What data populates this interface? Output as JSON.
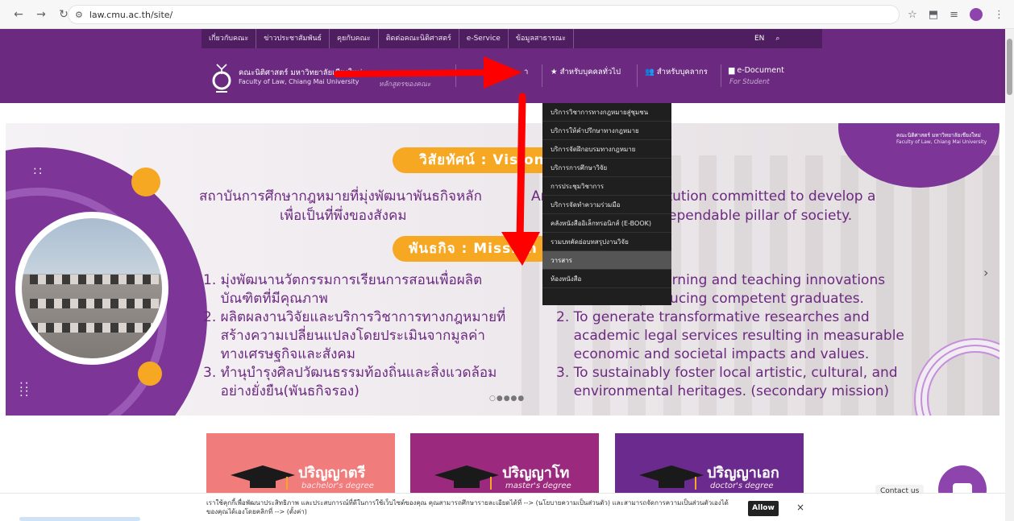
{
  "browser": {
    "url": "law.cmu.ac.th/site/",
    "back_icon": "back-arrow-icon",
    "forward_icon": "forward-arrow-icon",
    "reload_icon": "reload-icon"
  },
  "topbar": {
    "links": [
      "เกี่ยวกับคณะ",
      "ข่าวประชาสัมพันธ์",
      "คุยกับคณะ",
      "ติดต่อคณะนิติศาสตร์",
      "e-Service",
      "ข้อมูลสาธารณะ"
    ],
    "lang": "EN"
  },
  "header": {
    "logo_th": "คณะนิติศาสตร์ มหาวิทยาลัยเชียงใหม่",
    "logo_en": "Faculty of Law, Chiang Mai University",
    "menu_hidden_sub": "หลักสูตรของคณะ",
    "menu_partial": "า",
    "menu_public": "สำหรับบุคคลทั่วไป",
    "menu_staff": "สำหรับบุคลากร",
    "menu_edoc": "e-Document",
    "menu_edoc_sub": "For Student"
  },
  "dropdown": {
    "items": [
      "บริการวิชาการทางกฎหมายสู่ชุมชน",
      "บริการให้คำปรึกษาทางกฎหมาย",
      "บริการจัดฝึกอบรมทางกฎหมาย",
      "บริการการศึกษาวิจัย",
      "การประชุมวิชาการ",
      "บริการจัดทำความร่วมมือ",
      "คลังหนังสืออิเล็กทรอนิกส์ (E-BOOK)",
      "รวมบทคัดย่อบทสรุปงานวิจัย",
      "วารสาร",
      "ห้องหนังสือ"
    ],
    "active_index": 8
  },
  "hero": {
    "vision_label": "วิสัยทัศน์ : Vision",
    "vision_th_1": "สถาบันการศึกษากฎหมายที่มุ่งพัฒนาพันธกิจหลัก",
    "vision_th_2": "เพื่อเป็นที่พึ่งของสังคม",
    "vision_en_1": "An educational institution committed to develop a",
    "vision_en_2": "mission to be a dependable pillar of society.",
    "mission_label": "พันธกิจ : Mission",
    "mission_th": [
      "1. มุ่งพัฒนานวัตกรรมการเรียนการสอนเพื่อผลิต",
      "    บัณฑิตที่มีคุณภาพ",
      "2. ผลิตผลงานวิจัยและบริการวิชาการทางกฎหมายที่",
      "    สร้างความเปลี่ยนแปลงโดยประเมินจากมูลค่า",
      "    ทางเศรษฐกิจและสังคม",
      "3. ทำนุบำรุงศิลปวัฒนธรรมท้องถิ่นและสิ่งแวดล้อม",
      "    อย่างยั่งยืน(พันธกิจรอง)"
    ],
    "mission_en": [
      "1. To develop learning and teaching innovations",
      "    aimed at producing competent graduates.",
      "2. To generate transformative researches and",
      "    academic legal services resulting in measurable",
      "    economic and societal impacts and values.",
      "3. To sustainably foster local artistic, cultural, and",
      "    environmental heritages. (secondary mission)"
    ],
    "corner_th": "คณะนิติศาสตร์ มหาวิทยาลัยเชียงใหม่",
    "corner_en": "Faculty of Law, Chiang Mai University",
    "slide_dots": "○●●●●",
    "next_icon": "›"
  },
  "cards": [
    {
      "title": "ปริญญาตรี",
      "subtitle": "bachelor's degree",
      "color": "#f07c7c"
    },
    {
      "title": "ปริญญาโท",
      "subtitle": "master's degree",
      "color": "#9b2a7e"
    },
    {
      "title": "ปริญญาเอก",
      "subtitle": "doctor's degree",
      "color": "#6b2a8e"
    }
  ],
  "cookie": {
    "text": "เราใช้คุกกี้เพื่อพัฒนาประสิทธิภาพ และประสบการณ์ที่ดีในการใช้เว็บไซต์ของคุณ คุณสามารถศึกษารายละเอียดได้ที่ --> (นโยบายความเป็นส่วนตัว) และสามารถจัดการความเป็นส่วนตัวเองได้ของคุณได้เองโดยคลิกที่ --> (ตั้งค่า)",
    "allow": "Allow",
    "close": "×",
    "contact": "Contact us"
  },
  "colors": {
    "brand": "#6b2a80",
    "accent": "#f7a823",
    "annotation": "#ff0000"
  }
}
